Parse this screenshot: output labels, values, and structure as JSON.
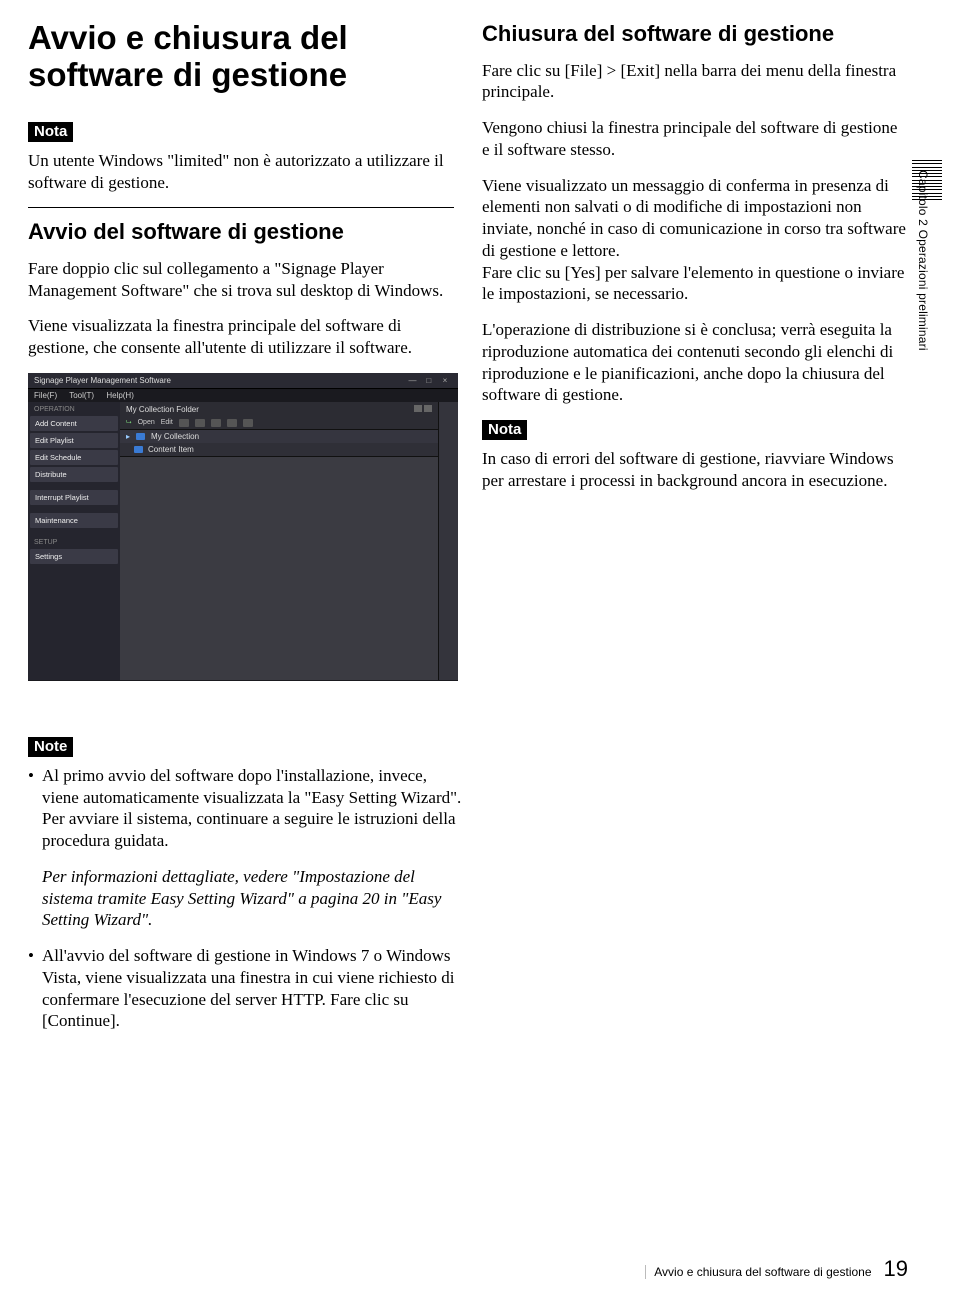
{
  "left": {
    "title": "Avvio e chiusura del software di gestione",
    "nota_label": "Nota",
    "nota_text": "Un utente Windows \"limited\" non è autorizzato a utilizzare il software di gestione.",
    "avvio_title": "Avvio del software di gestione",
    "avvio_p1": "Fare doppio clic sul collegamento a \"Signage Player Management Software\" che si trova sul desktop di Windows.",
    "avvio_p2": "Viene visualizzata la finestra principale del software di gestione, che consente all'utente di utilizzare il software."
  },
  "right": {
    "chiusura_title": "Chiusura del software di gestione",
    "p1": "Fare clic su [File] > [Exit] nella barra dei menu della finestra principale.",
    "p2": "Vengono chiusi la finestra principale del software di gestione e il software stesso.",
    "p3": "Viene visualizzato un messaggio di conferma in presenza di elementi non salvati o di modifiche di impostazioni non inviate, nonché in caso di comunicazione in corso tra software di gestione e lettore.\nFare clic su [Yes] per salvare l'elemento in questione o inviare le impostazioni, se necessario.",
    "p4": "L'operazione di distribuzione si è conclusa; verrà eseguita la riproduzione automatica dei contenuti secondo gli elenchi di riproduzione e le pianificazioni, anche dopo la chiusura del software di gestione.",
    "nota_label": "Nota",
    "nota_text": "In caso di errori del software di gestione, riavviare Windows per arrestare i processi in background ancora in esecuzione."
  },
  "notes": {
    "label": "Note",
    "b1p1": "Al primo avvio del software dopo l'installazione, invece, viene automaticamente visualizzata la \"Easy Setting Wizard\". Per avviare il sistema, continuare a seguire le istruzioni della procedura guidata.",
    "b1p2": "Per informazioni dettagliate, vedere \"Impostazione del sistema tramite Easy Setting Wizard\" a pagina 20 in \"Easy Setting Wizard\".",
    "b2": "All'avvio del software di gestione in Windows 7 o Windows Vista, viene visualizzata una finestra in cui viene richiesto di confermare l'esecuzione del server HTTP. Fare clic su [Continue]."
  },
  "app": {
    "title": "Signage Player Management Software",
    "menu_file": "File(F)",
    "menu_tool": "Tool(T)",
    "menu_help": "Help(H)",
    "section_operation": "OPERATION",
    "item_add": "Add Content",
    "item_playlist": "Edit Playlist",
    "item_schedule": "Edit Schedule",
    "item_distribute": "Distribute",
    "item_interrupt": "Interrupt Playlist",
    "item_maintenance": "Maintenance",
    "section_setup": "SETUP",
    "item_settings": "Settings",
    "crumb": "My Collection Folder",
    "btn_open": "Open",
    "btn_edit": "Edit",
    "row_mycollection": "My Collection",
    "row_content": "Content Item"
  },
  "side_label": "Capitolo 2  Operazioni preliminari",
  "footer_title": "Avvio e chiusura del software di gestione",
  "footer_page": "19"
}
